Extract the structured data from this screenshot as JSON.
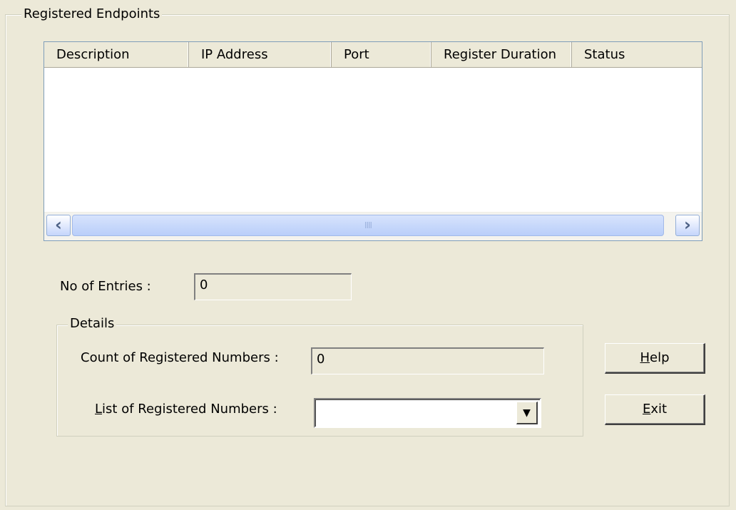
{
  "window": {
    "group_title": "Registered Endpoints"
  },
  "endpoints_list": {
    "columns": [
      "Description",
      "IP Address",
      "Port",
      "Register Duration",
      "Status"
    ],
    "rows": []
  },
  "scrollbar": {
    "left_icon": "scroll-left-arrow",
    "right_icon": "scroll-right-arrow",
    "thumb_grip": "IIII"
  },
  "entries": {
    "label": "No of Entries :",
    "value": "0"
  },
  "details": {
    "title": "Details",
    "count_label": "Count of Registered Numbers :",
    "count_value": "0",
    "list_label_prefix": "",
    "list_label_accel": "L",
    "list_label_rest": "ist of Registered Numbers :",
    "list_selected": ""
  },
  "buttons": {
    "help_accel": "H",
    "help_rest": "elp",
    "exit_accel": "E",
    "exit_rest": "xit"
  }
}
